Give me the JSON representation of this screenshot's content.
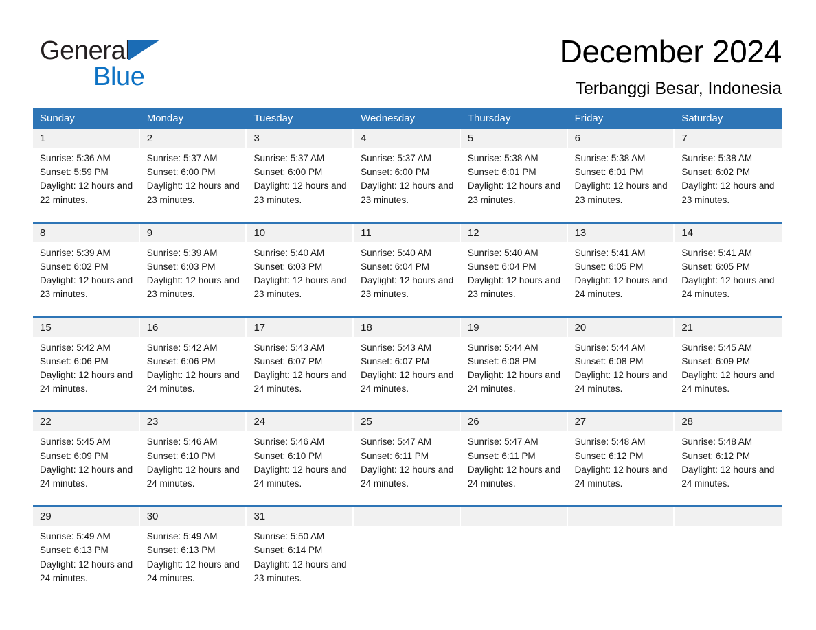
{
  "brand": {
    "name_part1": "General",
    "name_part2": "Blue",
    "triangle_color": "#1b6cb5",
    "blue_color": "#0d72c4"
  },
  "header": {
    "title": "December 2024",
    "subtitle": "Terbanggi Besar, Indonesia"
  },
  "theme": {
    "header_blue": "#2e75b6",
    "daynum_band": "#f1f1f1",
    "page_background": "#ffffff"
  },
  "weekday_headers": [
    "Sunday",
    "Monday",
    "Tuesday",
    "Wednesday",
    "Thursday",
    "Friday",
    "Saturday"
  ],
  "weeks": [
    [
      {
        "day": "1",
        "sunrise": "Sunrise: 5:36 AM",
        "sunset": "Sunset: 5:59 PM",
        "daylight": "Daylight: 12 hours and 22 minutes."
      },
      {
        "day": "2",
        "sunrise": "Sunrise: 5:37 AM",
        "sunset": "Sunset: 6:00 PM",
        "daylight": "Daylight: 12 hours and 23 minutes."
      },
      {
        "day": "3",
        "sunrise": "Sunrise: 5:37 AM",
        "sunset": "Sunset: 6:00 PM",
        "daylight": "Daylight: 12 hours and 23 minutes."
      },
      {
        "day": "4",
        "sunrise": "Sunrise: 5:37 AM",
        "sunset": "Sunset: 6:00 PM",
        "daylight": "Daylight: 12 hours and 23 minutes."
      },
      {
        "day": "5",
        "sunrise": "Sunrise: 5:38 AM",
        "sunset": "Sunset: 6:01 PM",
        "daylight": "Daylight: 12 hours and 23 minutes."
      },
      {
        "day": "6",
        "sunrise": "Sunrise: 5:38 AM",
        "sunset": "Sunset: 6:01 PM",
        "daylight": "Daylight: 12 hours and 23 minutes."
      },
      {
        "day": "7",
        "sunrise": "Sunrise: 5:38 AM",
        "sunset": "Sunset: 6:02 PM",
        "daylight": "Daylight: 12 hours and 23 minutes."
      }
    ],
    [
      {
        "day": "8",
        "sunrise": "Sunrise: 5:39 AM",
        "sunset": "Sunset: 6:02 PM",
        "daylight": "Daylight: 12 hours and 23 minutes."
      },
      {
        "day": "9",
        "sunrise": "Sunrise: 5:39 AM",
        "sunset": "Sunset: 6:03 PM",
        "daylight": "Daylight: 12 hours and 23 minutes."
      },
      {
        "day": "10",
        "sunrise": "Sunrise: 5:40 AM",
        "sunset": "Sunset: 6:03 PM",
        "daylight": "Daylight: 12 hours and 23 minutes."
      },
      {
        "day": "11",
        "sunrise": "Sunrise: 5:40 AM",
        "sunset": "Sunset: 6:04 PM",
        "daylight": "Daylight: 12 hours and 23 minutes."
      },
      {
        "day": "12",
        "sunrise": "Sunrise: 5:40 AM",
        "sunset": "Sunset: 6:04 PM",
        "daylight": "Daylight: 12 hours and 23 minutes."
      },
      {
        "day": "13",
        "sunrise": "Sunrise: 5:41 AM",
        "sunset": "Sunset: 6:05 PM",
        "daylight": "Daylight: 12 hours and 24 minutes."
      },
      {
        "day": "14",
        "sunrise": "Sunrise: 5:41 AM",
        "sunset": "Sunset: 6:05 PM",
        "daylight": "Daylight: 12 hours and 24 minutes."
      }
    ],
    [
      {
        "day": "15",
        "sunrise": "Sunrise: 5:42 AM",
        "sunset": "Sunset: 6:06 PM",
        "daylight": "Daylight: 12 hours and 24 minutes."
      },
      {
        "day": "16",
        "sunrise": "Sunrise: 5:42 AM",
        "sunset": "Sunset: 6:06 PM",
        "daylight": "Daylight: 12 hours and 24 minutes."
      },
      {
        "day": "17",
        "sunrise": "Sunrise: 5:43 AM",
        "sunset": "Sunset: 6:07 PM",
        "daylight": "Daylight: 12 hours and 24 minutes."
      },
      {
        "day": "18",
        "sunrise": "Sunrise: 5:43 AM",
        "sunset": "Sunset: 6:07 PM",
        "daylight": "Daylight: 12 hours and 24 minutes."
      },
      {
        "day": "19",
        "sunrise": "Sunrise: 5:44 AM",
        "sunset": "Sunset: 6:08 PM",
        "daylight": "Daylight: 12 hours and 24 minutes."
      },
      {
        "day": "20",
        "sunrise": "Sunrise: 5:44 AM",
        "sunset": "Sunset: 6:08 PM",
        "daylight": "Daylight: 12 hours and 24 minutes."
      },
      {
        "day": "21",
        "sunrise": "Sunrise: 5:45 AM",
        "sunset": "Sunset: 6:09 PM",
        "daylight": "Daylight: 12 hours and 24 minutes."
      }
    ],
    [
      {
        "day": "22",
        "sunrise": "Sunrise: 5:45 AM",
        "sunset": "Sunset: 6:09 PM",
        "daylight": "Daylight: 12 hours and 24 minutes."
      },
      {
        "day": "23",
        "sunrise": "Sunrise: 5:46 AM",
        "sunset": "Sunset: 6:10 PM",
        "daylight": "Daylight: 12 hours and 24 minutes."
      },
      {
        "day": "24",
        "sunrise": "Sunrise: 5:46 AM",
        "sunset": "Sunset: 6:10 PM",
        "daylight": "Daylight: 12 hours and 24 minutes."
      },
      {
        "day": "25",
        "sunrise": "Sunrise: 5:47 AM",
        "sunset": "Sunset: 6:11 PM",
        "daylight": "Daylight: 12 hours and 24 minutes."
      },
      {
        "day": "26",
        "sunrise": "Sunrise: 5:47 AM",
        "sunset": "Sunset: 6:11 PM",
        "daylight": "Daylight: 12 hours and 24 minutes."
      },
      {
        "day": "27",
        "sunrise": "Sunrise: 5:48 AM",
        "sunset": "Sunset: 6:12 PM",
        "daylight": "Daylight: 12 hours and 24 minutes."
      },
      {
        "day": "28",
        "sunrise": "Sunrise: 5:48 AM",
        "sunset": "Sunset: 6:12 PM",
        "daylight": "Daylight: 12 hours and 24 minutes."
      }
    ],
    [
      {
        "day": "29",
        "sunrise": "Sunrise: 5:49 AM",
        "sunset": "Sunset: 6:13 PM",
        "daylight": "Daylight: 12 hours and 24 minutes."
      },
      {
        "day": "30",
        "sunrise": "Sunrise: 5:49 AM",
        "sunset": "Sunset: 6:13 PM",
        "daylight": "Daylight: 12 hours and 24 minutes."
      },
      {
        "day": "31",
        "sunrise": "Sunrise: 5:50 AM",
        "sunset": "Sunset: 6:14 PM",
        "daylight": "Daylight: 12 hours and 23 minutes."
      },
      {
        "day": "",
        "sunrise": "",
        "sunset": "",
        "daylight": ""
      },
      {
        "day": "",
        "sunrise": "",
        "sunset": "",
        "daylight": ""
      },
      {
        "day": "",
        "sunrise": "",
        "sunset": "",
        "daylight": ""
      },
      {
        "day": "",
        "sunrise": "",
        "sunset": "",
        "daylight": ""
      }
    ]
  ]
}
